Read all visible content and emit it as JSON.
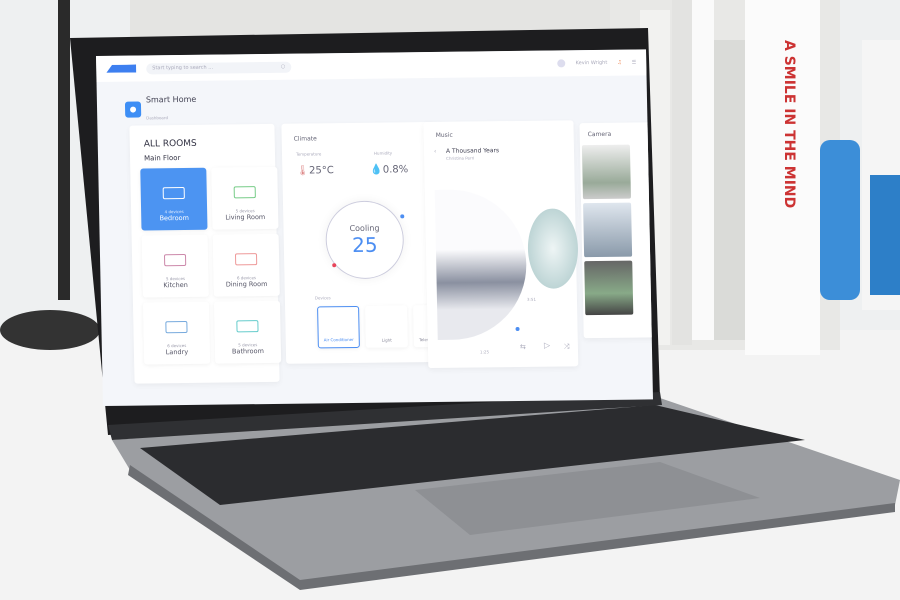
{
  "header": {
    "search_placeholder": "Start typing to search ...",
    "user_name": "Kevin Wright"
  },
  "page": {
    "title": "Smart Home",
    "subtitle": "Dashboard"
  },
  "rooms": {
    "title": "ALL ROOMS",
    "floor": "Main Floor",
    "items": [
      {
        "name": "Bedroom",
        "devices": "4 devices",
        "selected": true
      },
      {
        "name": "Living Room",
        "devices": "5 devices"
      },
      {
        "name": "Kitchen",
        "devices": "5 devices"
      },
      {
        "name": "Dining Room",
        "devices": "6 devices"
      },
      {
        "name": "Landry",
        "devices": "6 devices"
      },
      {
        "name": "Bathroom",
        "devices": "5 devices"
      }
    ]
  },
  "climate": {
    "title": "Climate",
    "temp_label": "Temperature",
    "temp": "25°C",
    "humidity_label": "Humidity",
    "humidity": "0.8%",
    "mode": "Cooling",
    "setpoint": "25",
    "devices_label": "Devices",
    "devices": [
      "Air Conditioner",
      "Light",
      "Television"
    ]
  },
  "music": {
    "title": "Music",
    "song": "A Thousand Years",
    "artist": "Christina Perri",
    "elapsed": "1:25",
    "total": "3:51"
  },
  "camera": {
    "title": "Camera"
  },
  "colors": {
    "accent": "#4c8ef2",
    "alert": "#e8445a"
  }
}
